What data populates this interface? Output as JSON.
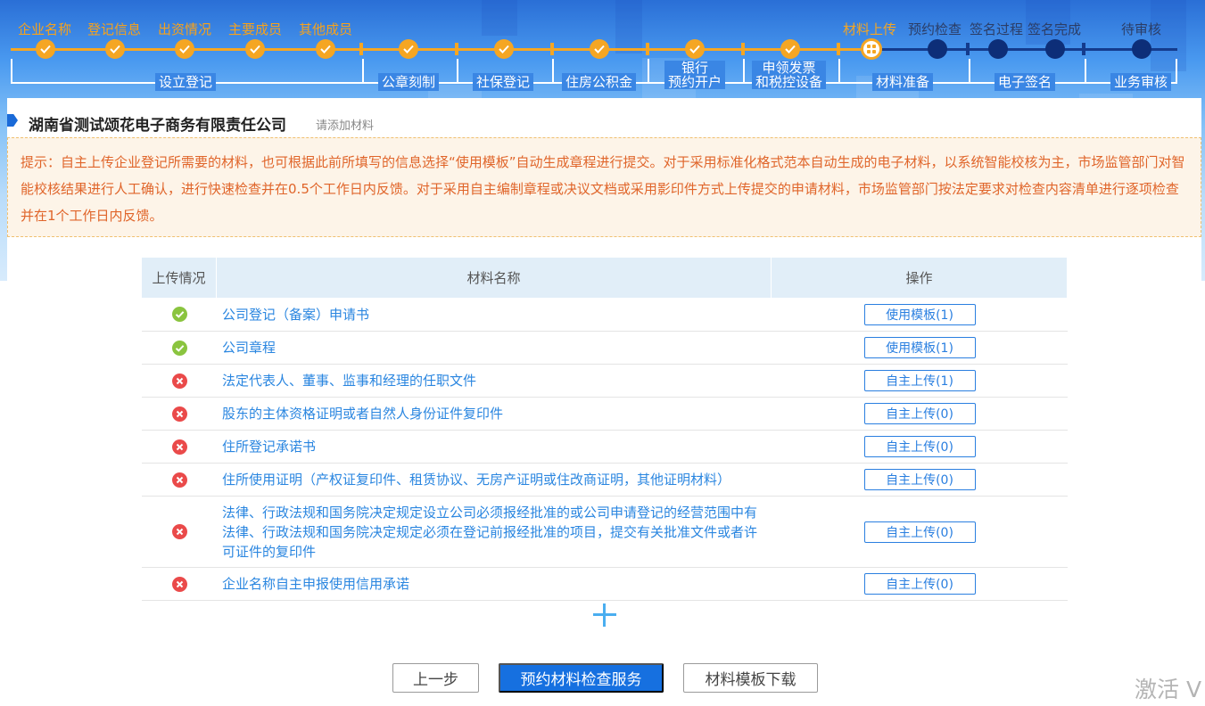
{
  "steps": {
    "items": [
      {
        "label": "企业名称",
        "state": "done"
      },
      {
        "label": "登记信息",
        "state": "done"
      },
      {
        "label": "出资情况",
        "state": "done"
      },
      {
        "label": "主要成员",
        "state": "done"
      },
      {
        "label": "其他成员",
        "state": "done"
      },
      {
        "label": "",
        "state": "done"
      },
      {
        "label": "",
        "state": "done"
      },
      {
        "label": "",
        "state": "done"
      },
      {
        "label": "",
        "state": "done"
      },
      {
        "label": "",
        "state": "done"
      },
      {
        "label": "材料上传",
        "state": "current"
      },
      {
        "label": "预约检查",
        "state": "todo"
      },
      {
        "label": "签名过程",
        "state": "todo"
      },
      {
        "label": "签名完成",
        "state": "todo"
      },
      {
        "label": "待审核",
        "state": "todo"
      }
    ],
    "groups": [
      {
        "label": "设立登记"
      },
      {
        "label": "公章刻制"
      },
      {
        "label": "社保登记"
      },
      {
        "label": "住房公积金"
      },
      {
        "line1": "银行",
        "line2": "预约开户"
      },
      {
        "line1": "申领发票",
        "line2": "和税控设备"
      },
      {
        "label": "材料准备"
      },
      {
        "label": "电子签名"
      },
      {
        "label": "业务审核"
      }
    ],
    "colors": {
      "done": "#f5a623",
      "todo": "#0d2e78"
    }
  },
  "company": {
    "name": "湖南省测试颂花电子商务有限责任公司",
    "add_hint": "请添加材料"
  },
  "notice": "提示：自主上传企业登记所需要的材料，也可根据此前所填写的信息选择“使用模板”自动生成章程进行提交。对于采用标准化格式范本自动生成的电子材料，以系统智能校核为主，市场监管部门对智能校核结果进行人工确认，进行快速检查并在0.5个工作日内反馈。对于采用自主编制章程或决议文档或采用影印件方式上传提交的申请材料，市场监管部门按法定要求对检查内容清单进行逐项检查并在1个工作日内反馈。",
  "table": {
    "headers": [
      "上传情况",
      "材料名称",
      "操作"
    ],
    "rows": [
      {
        "status": "ok",
        "name": "公司登记（备案）申请书",
        "action": "使用模板(1)"
      },
      {
        "status": "ok",
        "name": "公司章程",
        "action": "使用模板(1)"
      },
      {
        "status": "bad",
        "name": "法定代表人、董事、监事和经理的任职文件",
        "action": "自主上传(1)"
      },
      {
        "status": "bad",
        "name": "股东的主体资格证明或者自然人身份证件复印件",
        "action": "自主上传(0)"
      },
      {
        "status": "bad",
        "name": "住所登记承诺书",
        "action": "自主上传(0)"
      },
      {
        "status": "bad",
        "name": "住所使用证明（产权证复印件、租赁协议、无房产证明或住改商证明，其他证明材料）",
        "action": "自主上传(0)"
      },
      {
        "status": "bad",
        "name": "法律、行政法规和国务院决定规定设立公司必须报经批准的或公司申请登记的经营范围中有法律、行政法规和国务院决定规定必须在登记前报经批准的项目，提交有关批准文件或者许可证件的复印件",
        "action": "自主上传(0)"
      },
      {
        "status": "bad",
        "name": "企业名称自主申报使用信用承诺",
        "action": "自主上传(0)"
      }
    ]
  },
  "buttons": {
    "prev": "上一步",
    "check": "预约材料检查服务",
    "download": "材料模板下载"
  },
  "watermark": "激活 V"
}
